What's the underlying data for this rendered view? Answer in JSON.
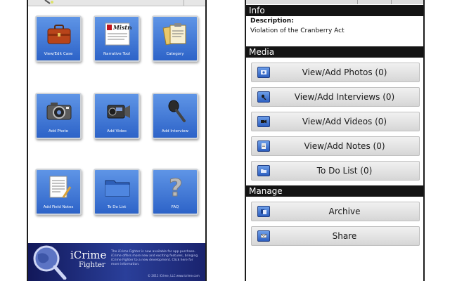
{
  "left_screen": {
    "tiles": [
      {
        "label": "View/Edit Case",
        "icon": "briefcase-icon"
      },
      {
        "label": "Narrative Tool",
        "icon": "mistral-document-icon",
        "icon_text": "Mistral"
      },
      {
        "label": "Category",
        "icon": "folders-clipboard-icon"
      },
      {
        "label": "Add Photo",
        "icon": "camera-icon"
      },
      {
        "label": "Add Video",
        "icon": "camcorder-icon"
      },
      {
        "label": "Add Interview",
        "icon": "microphone-icon"
      },
      {
        "label": "Add Field Notes",
        "icon": "notepad-icon"
      },
      {
        "label": "To Do List",
        "icon": "folder-icon"
      },
      {
        "label": "FAQ",
        "icon": "question-mark-icon"
      }
    ],
    "banner": {
      "logo_main": "iCrime",
      "logo_sub": "Fighter",
      "fine_print": "The iCrime Fighter is now available for app purchase. iCrime offers more new and exciting features, bringing iCrime Fighter to a new development. Click here for more information.",
      "copyright": "© 2011 iCrime, LLC  www.icrime.com"
    }
  },
  "right_screen": {
    "info": {
      "heading": "Info",
      "description_label": "Description:",
      "description_value": "Violation of the Cranberry Act"
    },
    "media": {
      "heading": "Media",
      "items": [
        {
          "label": "View/Add Photos (0)",
          "icon": "photo-icon"
        },
        {
          "label": "View/Add Interviews (0)",
          "icon": "microphone-icon"
        },
        {
          "label": "View/Add Videos (0)",
          "icon": "video-icon"
        },
        {
          "label": "View/Add Notes (0)",
          "icon": "notes-icon"
        },
        {
          "label": "To Do List (0)",
          "icon": "folder-icon"
        }
      ]
    },
    "manage": {
      "heading": "Manage",
      "items": [
        {
          "label": "Archive",
          "icon": "archive-icon"
        },
        {
          "label": "Share",
          "icon": "email-icon"
        }
      ]
    }
  },
  "colors": {
    "tile_blue": "#3b74d8",
    "section_bar": "#141414",
    "banner_navy": "#1a236e"
  }
}
